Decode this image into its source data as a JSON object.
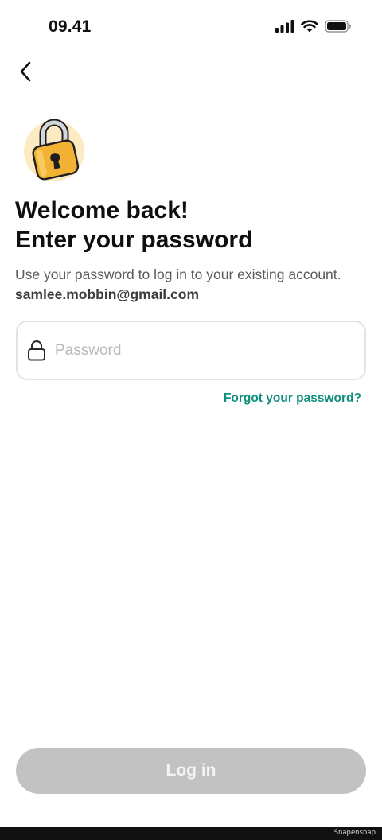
{
  "status_bar": {
    "time": "09.41",
    "icons": [
      "cellular-signal-icon",
      "wifi-icon",
      "battery-icon"
    ]
  },
  "nav": {
    "back_icon": "chevron-left-icon"
  },
  "illustration": {
    "icon": "padlock-illustration",
    "colors": {
      "body": "#F2B233",
      "glow": "#FCEBC2",
      "shackle": "#C9CDD2",
      "outline": "#1F1F1F"
    }
  },
  "header": {
    "title_line1": "Welcome back!",
    "title_line2": "Enter your password",
    "subtitle": "Use your password to log in to your existing account.",
    "email": "samlee.mobbin@gmail.com"
  },
  "form": {
    "password": {
      "icon": "lock-icon",
      "placeholder": "Password",
      "value": ""
    },
    "forgot_label": "Forgot your password?",
    "submit_label": "Log in"
  },
  "footer": {
    "watermark": "Snapensnap"
  },
  "colors": {
    "accent": "#0F8F7E",
    "button_disabled": "#C2C2C2",
    "field_border": "#E3E3E3"
  }
}
